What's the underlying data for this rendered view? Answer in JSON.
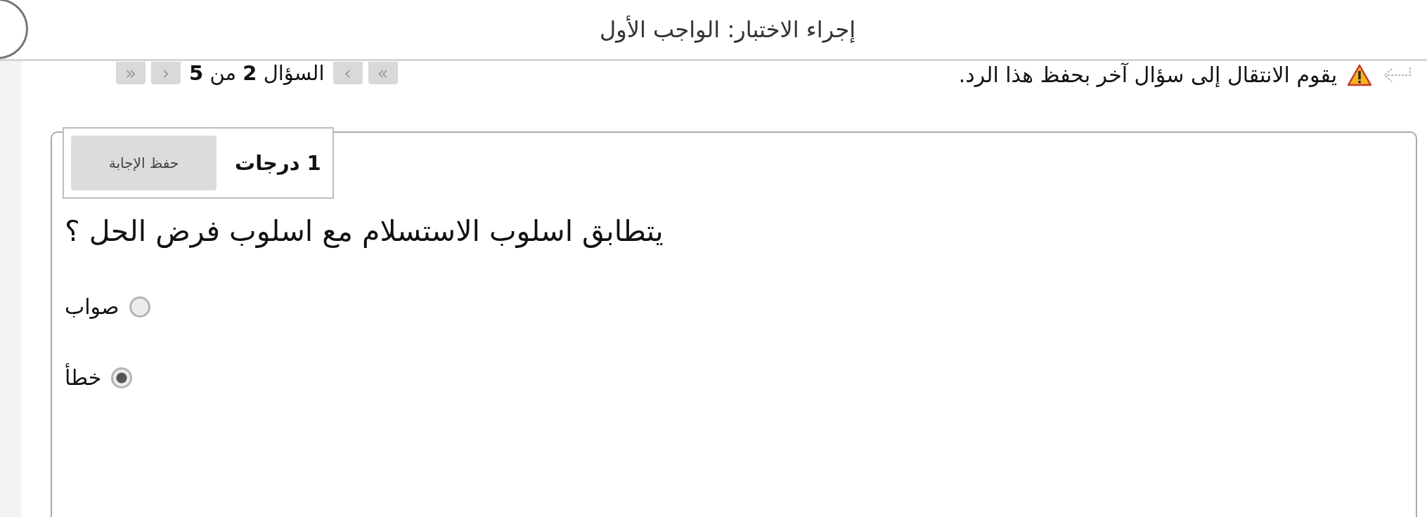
{
  "header": {
    "title": "إجراء الاختبار: الواجب الأول"
  },
  "navigation": {
    "buttons": [
      {
        "label": "»",
        "disabled": true
      },
      {
        "label": "›",
        "disabled": true
      }
    ],
    "position": "السؤال **2** من **5**",
    "buttons_after": [
      {
        "label": "‹",
        "disabled": true
      },
      {
        "label": "«",
        "disabled": true
      }
    ]
  },
  "notice": {
    "text": "يقوم الانتقال إلى سؤال آخر بحفظ هذا الرد."
  },
  "question": {
    "points": "1 درجات",
    "save_button": "حفظ الإجابة",
    "text": "يتطابق اسلوب الاستسلام مع اسلوب فرض الحل ؟",
    "options": [
      {
        "label": "صواب",
        "selected": false
      },
      {
        "label": "خطأ",
        "selected": true
      }
    ]
  }
}
